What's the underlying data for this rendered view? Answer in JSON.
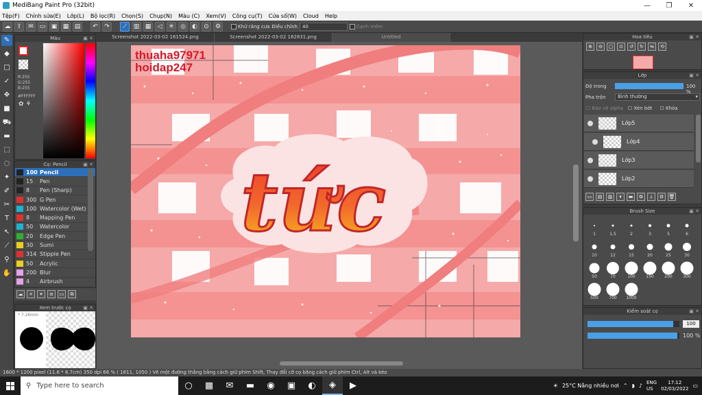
{
  "window": {
    "title": "MediBang Paint Pro (32bit)",
    "minimize": "—",
    "maximize": "❐",
    "close": "✕"
  },
  "menu": [
    "Tệp(F)",
    "Chỉnh sửa(E)",
    "Lớp(L)",
    "Bộ lọc(R)",
    "Chọn(S)",
    "Chụp(N)",
    "Màu (C)",
    "Xem(V)",
    "Công cụ(T)",
    "Cửa sổ(W)",
    "Cloud",
    "Help"
  ],
  "toolbar": {
    "antialias_label": "Khử răng cưa",
    "correction_label": "Điều chỉnh",
    "correction_value": "40",
    "snap_label": "Cạnh mềm"
  },
  "color_panel": {
    "title": "Màu",
    "r": "R:255",
    "g": "G:255",
    "b": "B:255",
    "hex": "#FFFFFF"
  },
  "brush_panel": {
    "title": "Cọ: Pencil",
    "items": [
      {
        "size": "100",
        "name": "Pencil",
        "color": "#222222"
      },
      {
        "size": "15",
        "name": "Pen",
        "color": "#222222"
      },
      {
        "size": "8",
        "name": "Pen (Sharp)",
        "color": "#222222"
      },
      {
        "size": "300",
        "name": "G Pen",
        "color": "#e03030"
      },
      {
        "size": "100",
        "name": "Watercolor (Wet)",
        "color": "#20b0d0"
      },
      {
        "size": "8",
        "name": "Mapping Pen",
        "color": "#e03030"
      },
      {
        "size": "50",
        "name": "Watercolor",
        "color": "#20b0d0"
      },
      {
        "size": "20",
        "name": "Edge Pen",
        "color": "#30b030"
      },
      {
        "size": "30",
        "name": "Sumi",
        "color": "#e8d020"
      },
      {
        "size": "314",
        "name": "Stipple Pen",
        "color": "#e03030"
      },
      {
        "size": "50",
        "name": "Acrylic",
        "color": "#e8d020"
      },
      {
        "size": "200",
        "name": "Blur",
        "color": "#e8a0e8"
      },
      {
        "size": "4",
        "name": "Airbrush",
        "color": "#e8a0e8"
      }
    ]
  },
  "preview_panel": {
    "title": "Xem trước cọ",
    "size_label": "7.26mm"
  },
  "tabs": [
    "Screenshot 2022-03-02 161524.png",
    "Screenshot 2022-03-02 162831.png",
    "Untitled"
  ],
  "artwork": {
    "watermark_line1": "thuaha97971",
    "watermark_line2": "hoidap247",
    "main_word": "tức"
  },
  "navigator": {
    "title": "Hoa tiêu"
  },
  "layer_panel": {
    "title": "Lớp",
    "opacity_label": "Độ trong",
    "opacity_value": "100 %",
    "blend_label": "Pha trộn",
    "blend_value": "Bình thường",
    "protect_alpha": "Bảo vệ alpha",
    "clipping": "Xén bớt",
    "lock": "Khóa",
    "layers": [
      "Lớp5",
      "Lớp4",
      "Lớp3",
      "Lớp2"
    ]
  },
  "brushsize_panel": {
    "title": "Brush Size",
    "sizes": [
      "1",
      "1.5",
      "2",
      "3",
      "5",
      "6",
      "10",
      "12",
      "15",
      "20",
      "25",
      "30",
      "50",
      "70",
      "100",
      "150",
      "200",
      "300",
      "500",
      "700",
      "1000"
    ]
  },
  "control_panel": {
    "title": "Kiểm soát cọ",
    "size_value": "100",
    "opacity_value": "100 %",
    "size_fraction": 0.93,
    "opacity_fraction": 0.98
  },
  "status": "1600 * 1200 pixel   (11.6 * 8.7cm)   350 dpi   66 %   ( 1811, 1050 )   Vẽ một đường thẳng bằng cách giữ phím Shift, Thay đổi cỡ cọ bằng cách giữ phím Ctrl, Alt và kéo",
  "taskbar": {
    "search_placeholder": "Type here to search",
    "weather": "25°C  Nắng nhiều nơi",
    "lang1": "ENG",
    "lang2": "US",
    "time": "17:12",
    "date": "02/03/2022"
  }
}
